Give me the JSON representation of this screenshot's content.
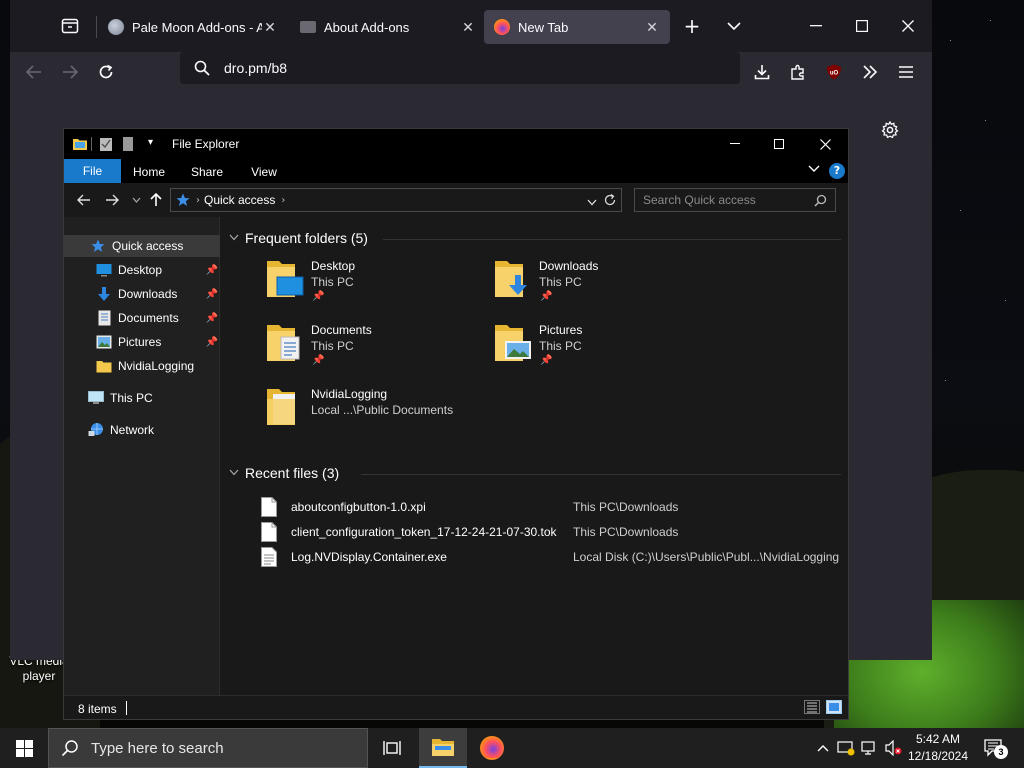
{
  "browser": {
    "tabs": [
      {
        "title": "Pale Moon Add-ons - Ab",
        "favicon": "pale-moon-icon",
        "selected": false
      },
      {
        "title": "About Add-ons",
        "favicon": "addons-icon",
        "selected": false
      },
      {
        "title": "New Tab",
        "favicon": "firefox-icon",
        "selected": true
      }
    ],
    "url": "dro.pm/b8",
    "new_tab_symbol": "+",
    "list_all_tabs_symbol": "⌄"
  },
  "explorer": {
    "title": "File Explorer",
    "ribbon_tabs": [
      "File",
      "Home",
      "Share",
      "View"
    ],
    "help_label": "?",
    "address": {
      "crumb": "Quick access"
    },
    "search_placeholder": "Search Quick access",
    "nav_pane": [
      {
        "label": "Quick access",
        "icon": "star-icon",
        "pinned": false,
        "selected": true
      },
      {
        "label": "Desktop",
        "icon": "desktop-icon",
        "pinned": true
      },
      {
        "label": "Downloads",
        "icon": "download-arrow-icon",
        "pinned": true
      },
      {
        "label": "Documents",
        "icon": "document-icon",
        "pinned": true
      },
      {
        "label": "Pictures",
        "icon": "picture-icon",
        "pinned": true
      },
      {
        "label": "NvidiaLogging",
        "icon": "folder-icon",
        "pinned": false
      },
      {
        "label": "This PC",
        "icon": "computer-icon",
        "pinned": false
      },
      {
        "label": "Network",
        "icon": "network-icon",
        "pinned": false
      }
    ],
    "frequent_header": "Frequent folders (5)",
    "frequent_folders": [
      {
        "name": "Desktop",
        "location": "This PC",
        "pinned": true,
        "icon": "desktop-folder-icon"
      },
      {
        "name": "Downloads",
        "location": "This PC",
        "pinned": true,
        "icon": "downloads-folder-icon"
      },
      {
        "name": "Documents",
        "location": "This PC",
        "pinned": true,
        "icon": "documents-folder-icon"
      },
      {
        "name": "Pictures",
        "location": "This PC",
        "pinned": true,
        "icon": "pictures-folder-icon"
      },
      {
        "name": "NvidiaLogging",
        "location": "Local ...\\Public Documents",
        "pinned": false,
        "icon": "folder-icon"
      }
    ],
    "recent_header": "Recent files (3)",
    "recent_files": [
      {
        "name": "aboutconfigbutton-1.0.xpi",
        "path": "This PC\\Downloads"
      },
      {
        "name": "client_configuration_token_17-12-24-21-07-30.tok",
        "path": "This PC\\Downloads"
      },
      {
        "name": "Log.NVDisplay.Container.exe",
        "path": "Local Disk (C:)\\Users\\Public\\Publ...\\NvidiaLogging"
      }
    ],
    "status_count": "8 items"
  },
  "desktop": {
    "vlc_label_line1": "VLC media",
    "vlc_label_line2": "player"
  },
  "taskbar": {
    "search_placeholder": "Type here to search",
    "time": "5:42 AM",
    "date": "12/18/2024",
    "notification_count": "3"
  }
}
